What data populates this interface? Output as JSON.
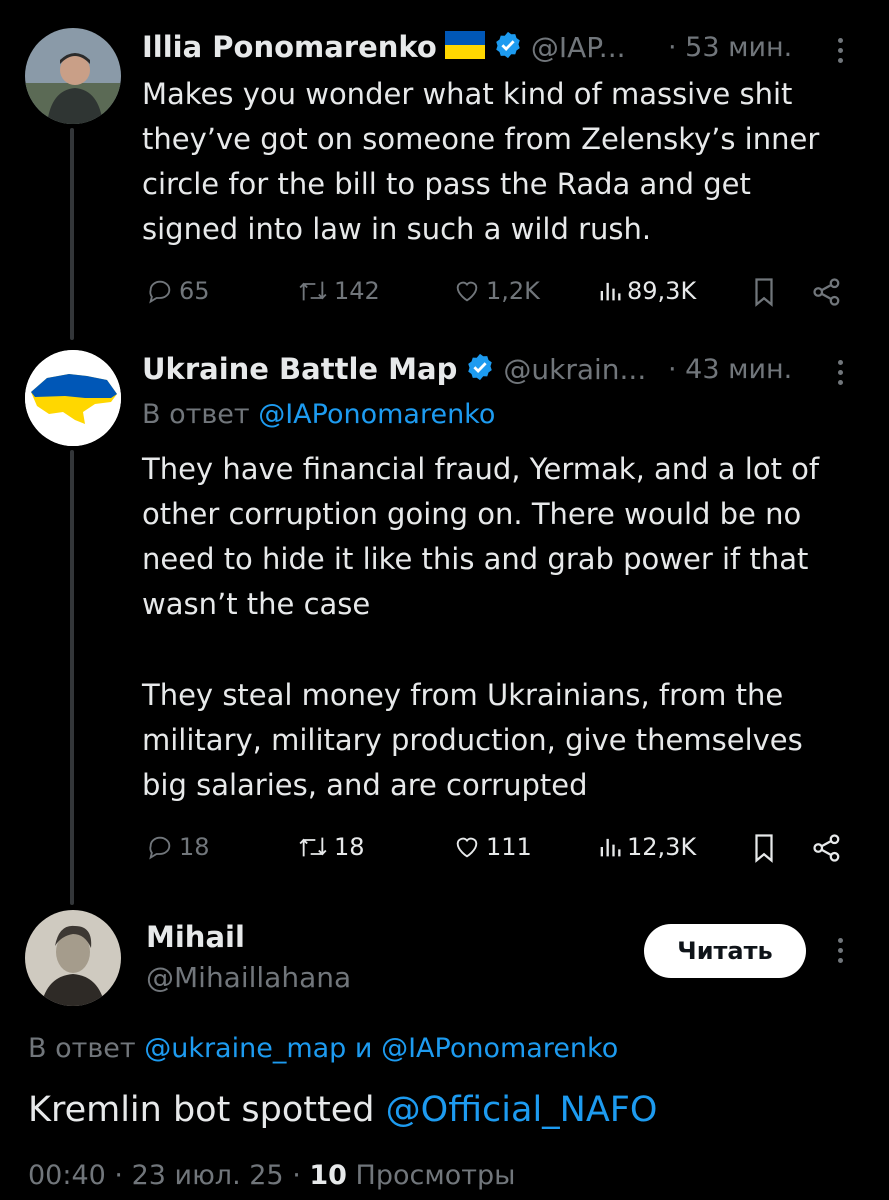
{
  "tweet1": {
    "name": "Illia Ponomarenko",
    "handle": "@IAP...",
    "time": "· 53 мин.",
    "lines": [
      "Makes you wonder what kind of massive shit",
      "they’ve got on someone from Zelensky’s inner",
      "circle for the bill to pass the Rada and get",
      "signed into law in such a wild rush."
    ],
    "stats": {
      "replies": "65",
      "reposts": "142",
      "likes": "1,2K",
      "views": "89,3K"
    }
  },
  "tweet2": {
    "name": "Ukraine Battle Map",
    "handle": "@ukrain...",
    "time": "· 43 мин.",
    "reply_prefix": "В ответ",
    "reply_to": "@IAPonomarenko",
    "lines": [
      "They have financial fraud, Yermak, and a lot of",
      "other corruption going on. There would be no",
      "need to hide it like this and grab power if that",
      "wasn’t the case",
      "They steal money from Ukrainians, from the",
      "military, military production, give themselves",
      "big salaries, and are corrupted"
    ],
    "stats": {
      "replies": "18",
      "reposts": "18",
      "likes": "111",
      "views": "12,3K"
    }
  },
  "tweet3": {
    "name": "Mihail",
    "handle": "@Mihaillahana",
    "follow_label": "Читать",
    "reply_prefix": "В ответ",
    "reply_to_1": "@ukraine_map",
    "reply_and": "и",
    "reply_to_2": "@IAPonomarenko",
    "text": "Kremlin bot spotted",
    "mention": "@Official_NAFO",
    "time": "00:40",
    "date": "23 июл. 25",
    "views_count": "10",
    "views_label": "Просмотры"
  },
  "colors": {
    "accent": "#1d9bf0",
    "muted": "#71767b",
    "text": "#e7e9ea",
    "background": "#000000"
  },
  "icons": [
    "verified-badge-icon",
    "ukraine-flag-icon",
    "reply-icon",
    "repost-icon",
    "like-icon",
    "views-icon",
    "bookmark-icon",
    "share-icon",
    "more-icon"
  ]
}
